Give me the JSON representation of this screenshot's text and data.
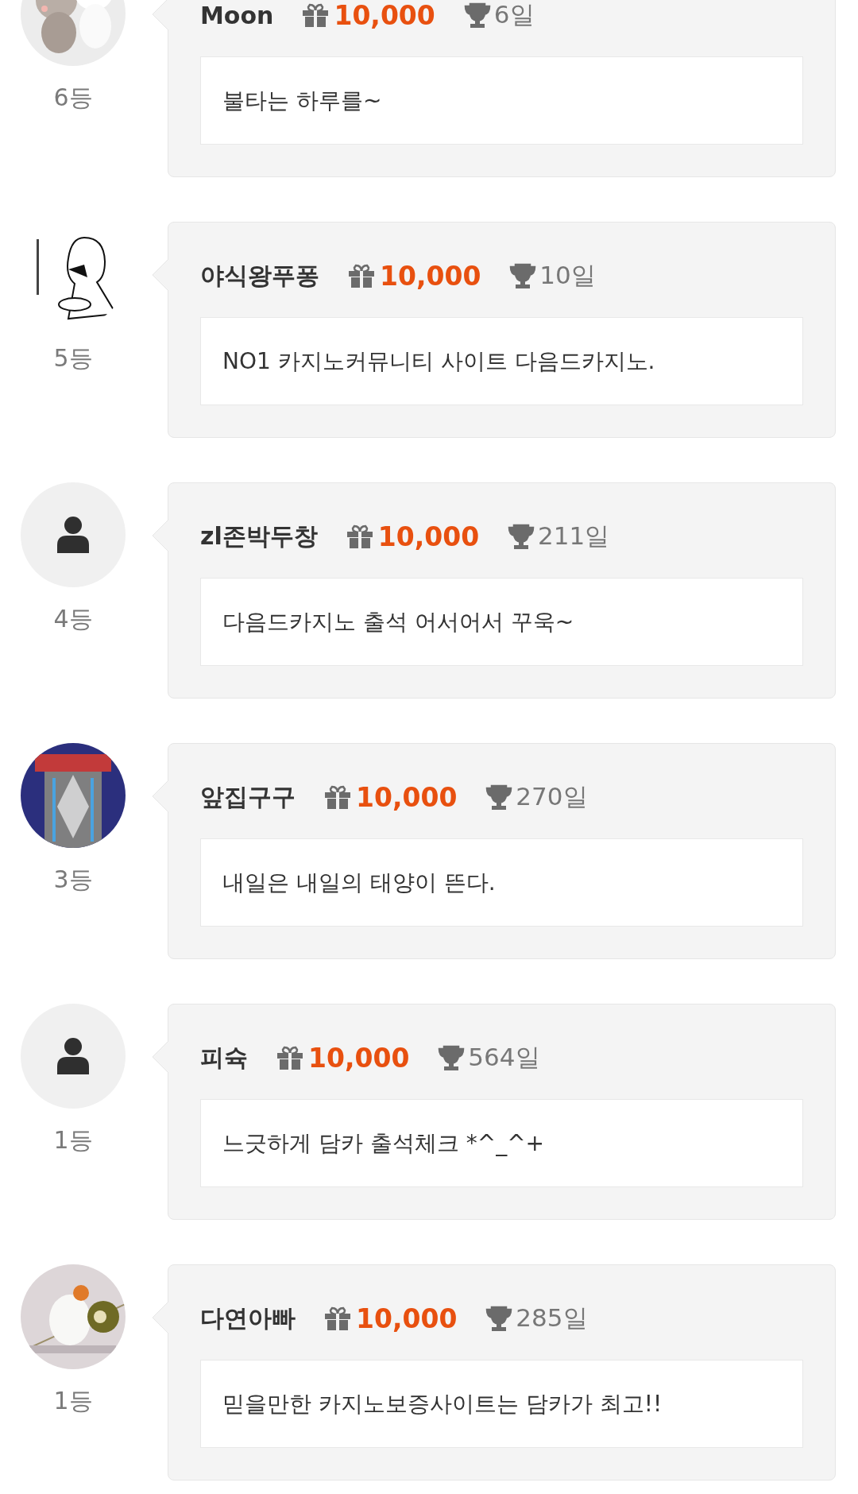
{
  "comments": [
    {
      "rank": "6등",
      "name": "Moon",
      "points": "10,000",
      "days": "6일",
      "message": "불타는 하루를~"
    },
    {
      "rank": "5등",
      "name": "야식왕푸퐁",
      "points": "10,000",
      "days": "10일",
      "message": "NO1 카지노커뮤니티 사이트 다음드카지노."
    },
    {
      "avatar": {
        "kind": "default"
      },
      "rank": "4등",
      "name": "zl존박두창",
      "points": "10,000",
      "days": "211일",
      "message": "다음드카지노 출석 어서어서 꾸욱~"
    },
    {
      "rank": "3등",
      "name": "앞집구구",
      "points": "10,000",
      "days": "270일",
      "message": "내일은 내일의 태양이 뜬다."
    },
    {
      "avatar": {
        "kind": "default"
      },
      "rank": "1등",
      "name": "피슉",
      "points": "10,000",
      "days": "564일",
      "message": "느긋하게 담카 출석체크 *^_^+"
    },
    {
      "rank": "1등",
      "name": "다연아빠",
      "points": "10,000",
      "days": "285일",
      "message": "믿을만한 카지노보증사이트는 담카가 최고!!"
    }
  ]
}
